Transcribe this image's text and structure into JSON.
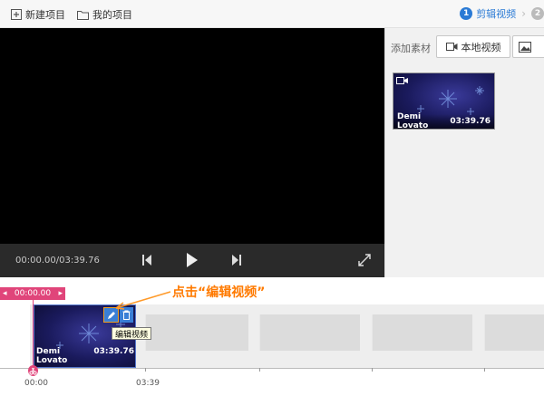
{
  "toolbar": {
    "new_project": "新建项目",
    "my_projects": "我的项目"
  },
  "steps": {
    "current_number": "1",
    "current_label": "剪辑视频",
    "next_number": "2"
  },
  "player": {
    "timecode": "00:00.00/03:39.76"
  },
  "media_panel": {
    "add_label": "添加素材",
    "local_video_button": "本地视频",
    "thumbnail": {
      "title": "Demi Lovato",
      "duration": "03:39.76"
    }
  },
  "timeline": {
    "playhead_time": "00:00.00",
    "clip": {
      "title": "Demi Lovato",
      "duration": "03:39.76"
    },
    "edit_tooltip": "编辑视频",
    "hint_text": "点击“编辑视频”",
    "ruler_labels": [
      "00:00",
      "03:39"
    ]
  },
  "colors": {
    "accent_blue": "#2a7ad5",
    "playhead_pink": "#e0457a",
    "hint_orange": "#ff7a00"
  }
}
